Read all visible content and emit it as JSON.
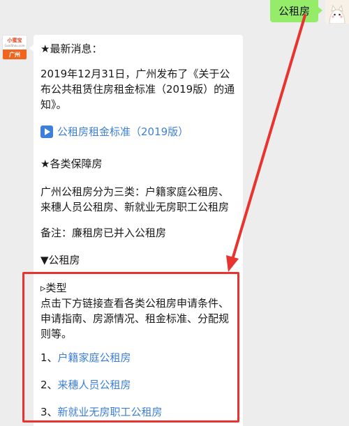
{
  "outgoing": {
    "text": "公租房"
  },
  "avatar": {
    "brand": "小蜜宝",
    "url": "GuaiShou.com",
    "city": "广州"
  },
  "message": {
    "news_heading": "★最新消息：",
    "news_body": "2019年12月31日，广州发布了《关于公布公共租赁住房租金标准（2019版）的通知》。",
    "link_rent_standard": "公租房租金标准（2019版）",
    "types_heading": "★各类保障房",
    "types_body": "广州公租房分为三类：户籍家庭公租房、来穗人员公租房、新就业无房职工公租房",
    "note": "备注：廉租房已并入公租房",
    "section_heading": "▼公租房",
    "sub_heading": "▹类型",
    "description": "点击下方链接查看各类公租房申请条件、申请指南、房源情况、租金标准、分配规则等。",
    "items": [
      {
        "prefix": "1、",
        "label": "户籍家庭公租房"
      },
      {
        "prefix": "2、",
        "label": "来穗人员公租房"
      },
      {
        "prefix": "3、",
        "label": "新就业无房职工公租房"
      }
    ]
  },
  "colors": {
    "link": "#3d7fd9",
    "annotation": "#e8332f",
    "outgoing_bubble": "#95ec69",
    "background": "#ededed"
  }
}
